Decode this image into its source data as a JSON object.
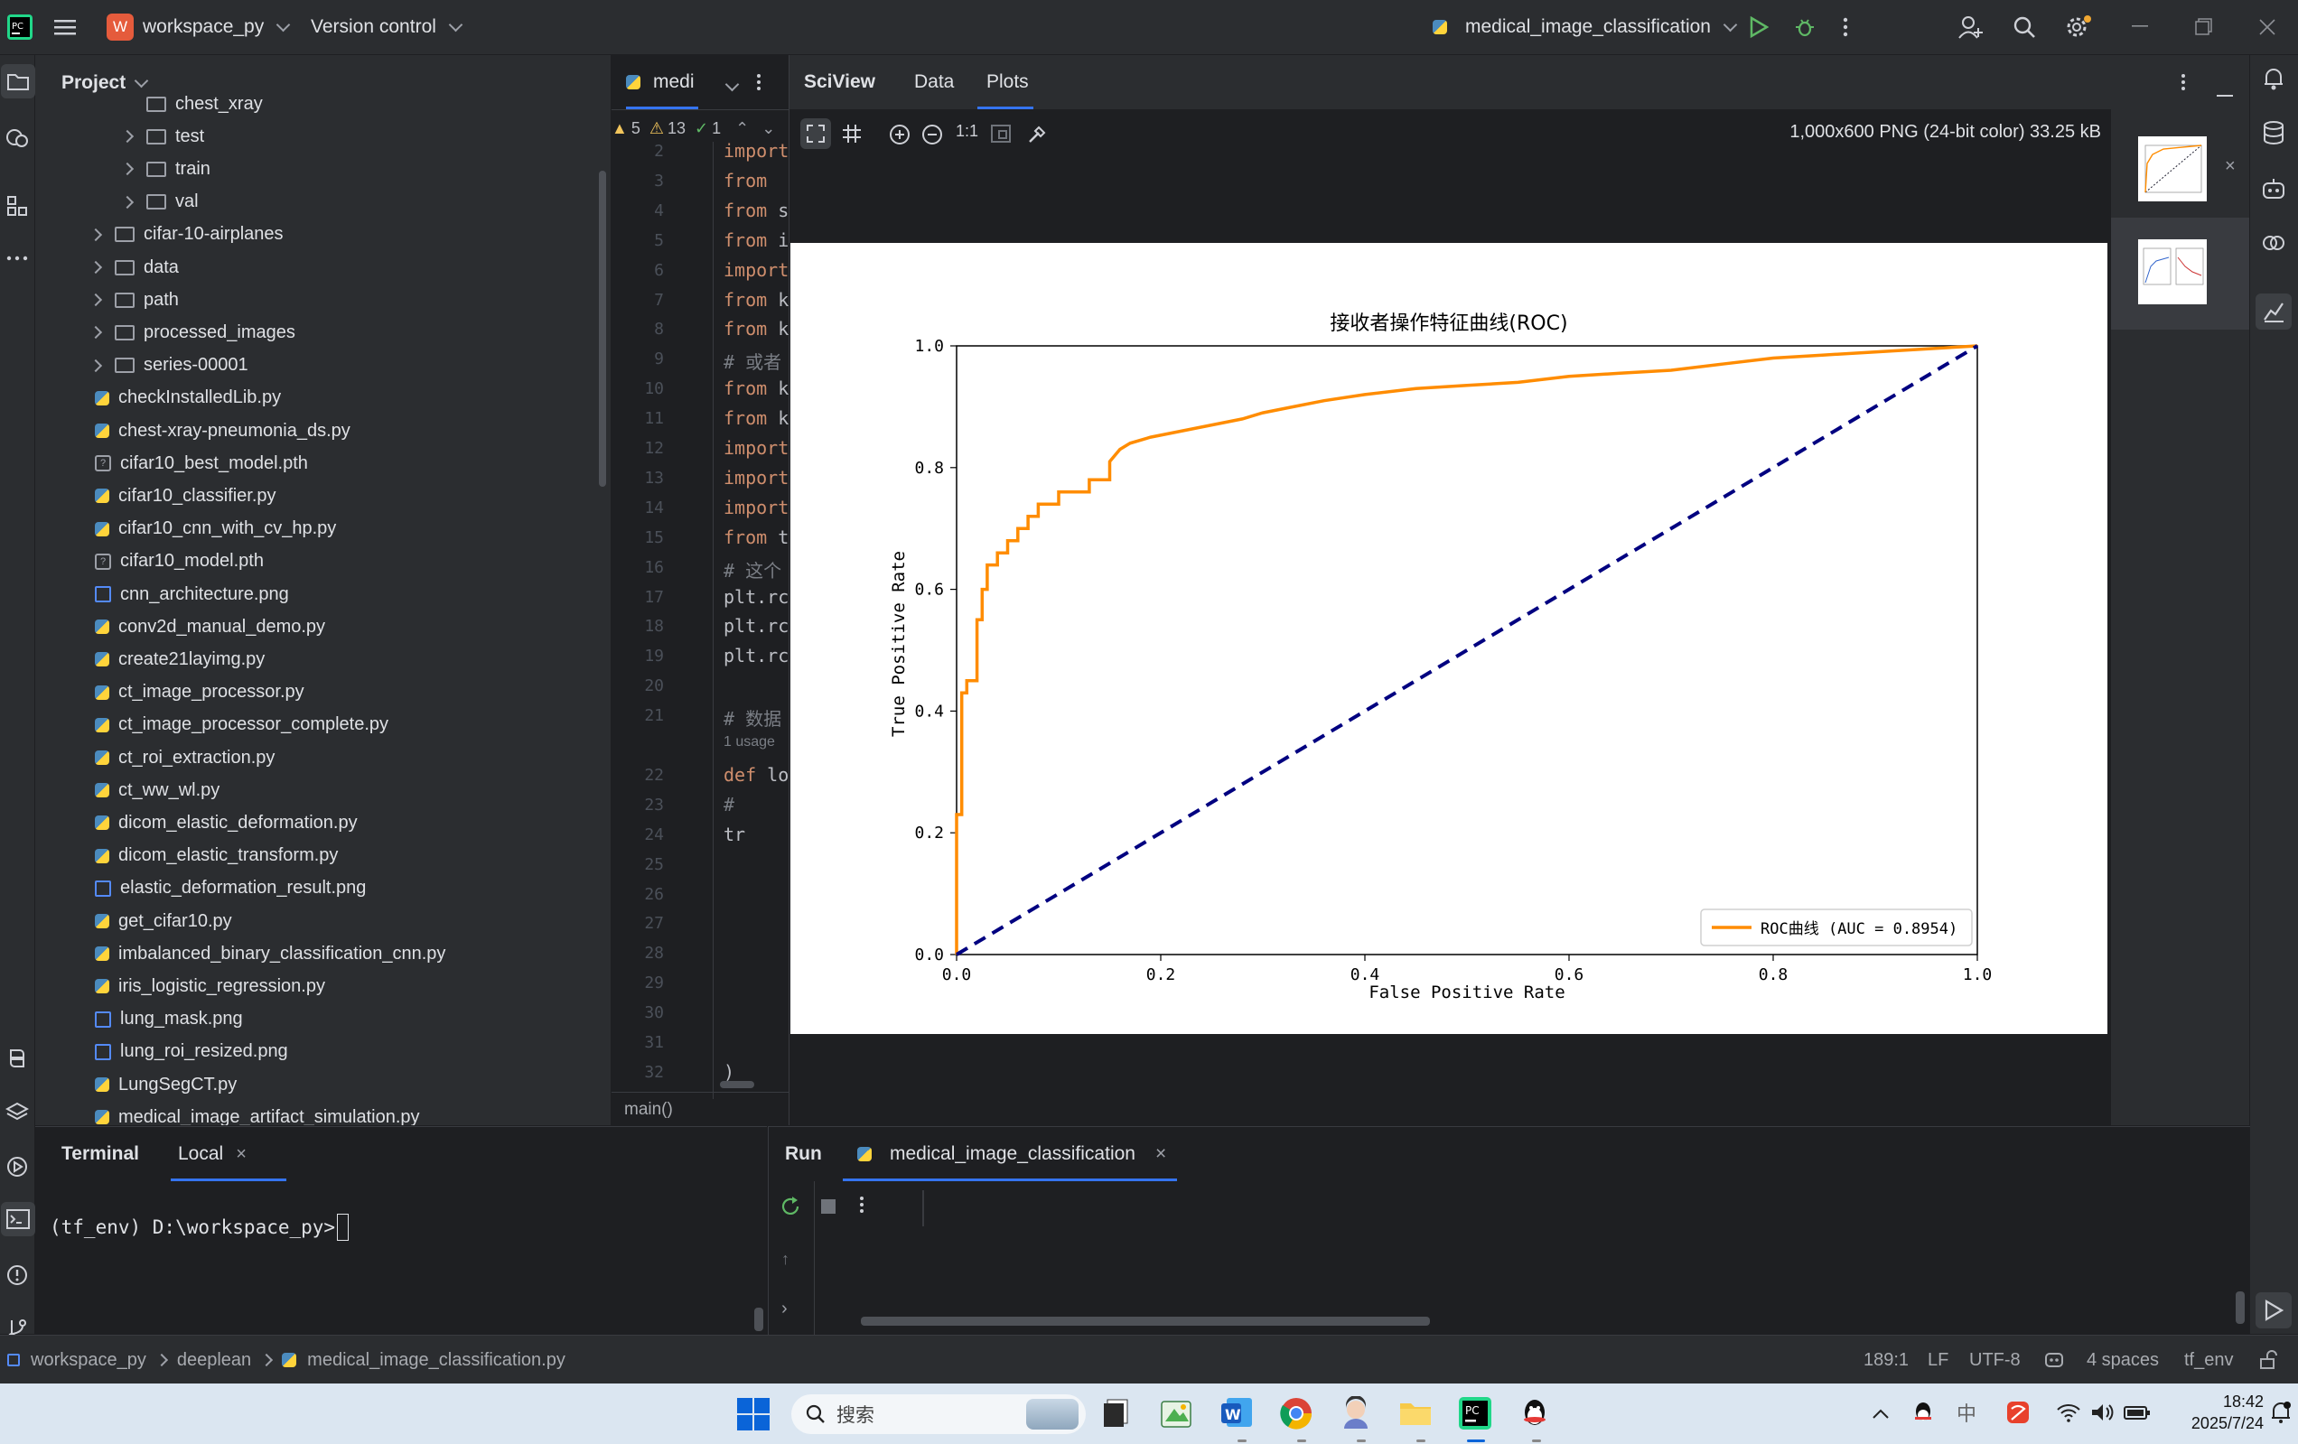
{
  "titlebar": {
    "project_name": "workspace_py",
    "project_badge": "W",
    "vcs": "Version control",
    "run_config": "medical_image_classification"
  },
  "project_panel": {
    "title": "Project",
    "items": [
      {
        "label": "chest_xray",
        "type": "folder",
        "depth": 2,
        "expand": "none"
      },
      {
        "label": "test",
        "type": "folder",
        "depth": 2,
        "expand": "collapsed"
      },
      {
        "label": "train",
        "type": "folder",
        "depth": 2,
        "expand": "collapsed"
      },
      {
        "label": "val",
        "type": "folder",
        "depth": 2,
        "expand": "collapsed"
      },
      {
        "label": "cifar-10-airplanes",
        "type": "folder",
        "depth": 1,
        "expand": "collapsed"
      },
      {
        "label": "data",
        "type": "folder",
        "depth": 1,
        "expand": "collapsed"
      },
      {
        "label": "path",
        "type": "folder",
        "depth": 1,
        "expand": "collapsed"
      },
      {
        "label": "processed_images",
        "type": "folder",
        "depth": 1,
        "expand": "collapsed"
      },
      {
        "label": "series-00001",
        "type": "folder",
        "depth": 1,
        "expand": "collapsed"
      },
      {
        "label": "checkInstalledLib.py",
        "type": "py",
        "depth": 1
      },
      {
        "label": "chest-xray-pneumonia_ds.py",
        "type": "py",
        "depth": 1
      },
      {
        "label": "cifar10_best_model.pth",
        "type": "unknown",
        "depth": 1
      },
      {
        "label": "cifar10_classifier.py",
        "type": "py",
        "depth": 1
      },
      {
        "label": "cifar10_cnn_with_cv_hp.py",
        "type": "py",
        "depth": 1
      },
      {
        "label": "cifar10_model.pth",
        "type": "unknown",
        "depth": 1
      },
      {
        "label": "cnn_architecture.png",
        "type": "img",
        "depth": 1
      },
      {
        "label": "conv2d_manual_demo.py",
        "type": "py",
        "depth": 1
      },
      {
        "label": "create21layimg.py",
        "type": "py",
        "depth": 1
      },
      {
        "label": "ct_image_processor.py",
        "type": "py",
        "depth": 1
      },
      {
        "label": "ct_image_processor_complete.py",
        "type": "py",
        "depth": 1
      },
      {
        "label": "ct_roi_extraction.py",
        "type": "py",
        "depth": 1
      },
      {
        "label": "ct_ww_wl.py",
        "type": "py",
        "depth": 1
      },
      {
        "label": "dicom_elastic_deformation.py",
        "type": "py",
        "depth": 1
      },
      {
        "label": "dicom_elastic_transform.py",
        "type": "py",
        "depth": 1
      },
      {
        "label": "elastic_deformation_result.png",
        "type": "img",
        "depth": 1
      },
      {
        "label": "get_cifar10.py",
        "type": "py",
        "depth": 1
      },
      {
        "label": "imbalanced_binary_classification_cnn.py",
        "type": "py",
        "depth": 1
      },
      {
        "label": "iris_logistic_regression.py",
        "type": "py",
        "depth": 1
      },
      {
        "label": "lung_mask.png",
        "type": "img",
        "depth": 1
      },
      {
        "label": "lung_roi_resized.png",
        "type": "img",
        "depth": 1
      },
      {
        "label": "LungSegCT.py",
        "type": "py",
        "depth": 1
      },
      {
        "label": "medical_image_artifact_simulation.py",
        "type": "py",
        "depth": 1
      }
    ]
  },
  "editor": {
    "tab_label": "medi",
    "warnings": "5",
    "weak_warnings": "13",
    "checks": "1",
    "lines": [
      {
        "n": "2",
        "k": "import",
        "r": ""
      },
      {
        "n": "3",
        "k": "from",
        "r": ""
      },
      {
        "n": "4",
        "k": "from",
        "r": " s"
      },
      {
        "n": "5",
        "k": "from",
        "r": " i"
      },
      {
        "n": "6",
        "k": "import",
        "r": ""
      },
      {
        "n": "7",
        "k": "from",
        "r": " k"
      },
      {
        "n": "8",
        "k": "from",
        "r": " k"
      },
      {
        "n": "9",
        "k": "",
        "r": "# 或者"
      },
      {
        "n": "10",
        "k": "from",
        "r": " k"
      },
      {
        "n": "11",
        "k": "from",
        "r": " k"
      },
      {
        "n": "12",
        "k": "import",
        "r": ""
      },
      {
        "n": "13",
        "k": "import",
        "r": ""
      },
      {
        "n": "14",
        "k": "import",
        "r": ""
      },
      {
        "n": "15",
        "k": "from",
        "r": " t"
      },
      {
        "n": "16",
        "k": "",
        "r": "#  这个"
      },
      {
        "n": "17",
        "k": "",
        "r": "plt.rc"
      },
      {
        "n": "18",
        "k": "",
        "r": "plt.rc"
      },
      {
        "n": "19",
        "k": "",
        "r": "plt.rc"
      },
      {
        "n": "20",
        "k": "",
        "r": ""
      },
      {
        "n": "21",
        "k": "",
        "r": "# 数据"
      }
    ],
    "usage_hint": "1 usage",
    "lines2": [
      {
        "n": "22",
        "k": "def",
        "r": " lo"
      },
      {
        "n": "23",
        "k": "",
        "r": "    #"
      },
      {
        "n": "24",
        "k": "",
        "r": "    tr"
      },
      {
        "n": "25",
        "k": "",
        "r": ""
      },
      {
        "n": "26",
        "k": "",
        "r": ""
      },
      {
        "n": "27",
        "k": "",
        "r": ""
      },
      {
        "n": "28",
        "k": "",
        "r": ""
      },
      {
        "n": "29",
        "k": "",
        "r": ""
      },
      {
        "n": "30",
        "k": "",
        "r": ""
      },
      {
        "n": "31",
        "k": "",
        "r": ""
      },
      {
        "n": "32",
        "k": "",
        "r": "    )"
      }
    ],
    "breadcrumb": "main()"
  },
  "sciview": {
    "tabs": [
      "SciView",
      "Data",
      "Plots"
    ],
    "image_info": "1,000x600 PNG (24-bit color) 33.25 kB",
    "zoom_label": "1:1"
  },
  "chart_data": {
    "type": "line",
    "title": "接收者操作特征曲线(ROC)",
    "xlabel": "False Positive Rate",
    "ylabel": "True Positive Rate",
    "xlim": [
      0.0,
      1.0
    ],
    "ylim": [
      0.0,
      1.0
    ],
    "xticks": [
      "0.0",
      "0.2",
      "0.4",
      "0.6",
      "0.8",
      "1.0"
    ],
    "yticks": [
      "0.0",
      "0.2",
      "0.4",
      "0.6",
      "0.8",
      "1.0"
    ],
    "legend_position": "lower-right",
    "grid": false,
    "series": [
      {
        "name": "ROC曲线 (AUC = 0.8954)",
        "color": "#ff8c00",
        "style": "solid",
        "x": [
          0.0,
          0.0,
          0.005,
          0.005,
          0.01,
          0.01,
          0.02,
          0.02,
          0.025,
          0.025,
          0.03,
          0.03,
          0.04,
          0.04,
          0.05,
          0.05,
          0.06,
          0.06,
          0.07,
          0.07,
          0.08,
          0.08,
          0.1,
          0.1,
          0.13,
          0.13,
          0.15,
          0.15,
          0.16,
          0.17,
          0.19,
          0.22,
          0.25,
          0.28,
          0.3,
          0.33,
          0.36,
          0.4,
          0.45,
          0.5,
          0.55,
          0.6,
          0.65,
          0.7,
          0.75,
          0.8,
          0.85,
          0.9,
          0.95,
          1.0
        ],
        "y": [
          0.0,
          0.23,
          0.23,
          0.43,
          0.43,
          0.45,
          0.45,
          0.55,
          0.55,
          0.6,
          0.6,
          0.64,
          0.64,
          0.66,
          0.66,
          0.68,
          0.68,
          0.7,
          0.7,
          0.72,
          0.72,
          0.74,
          0.74,
          0.76,
          0.76,
          0.78,
          0.78,
          0.81,
          0.83,
          0.84,
          0.85,
          0.86,
          0.87,
          0.88,
          0.89,
          0.9,
          0.91,
          0.92,
          0.93,
          0.935,
          0.94,
          0.95,
          0.955,
          0.96,
          0.97,
          0.98,
          0.985,
          0.99,
          0.995,
          1.0
        ]
      },
      {
        "name": "",
        "color": "#000080",
        "style": "dashed",
        "x": [
          0.0,
          1.0
        ],
        "y": [
          0.0,
          1.0
        ]
      }
    ]
  },
  "terminal": {
    "tab_title": "Terminal",
    "session_tab": "Local",
    "prompt": "(tf_env) D:\\workspace_py>"
  },
  "run": {
    "title": "Run",
    "config_tab": "medical_image_classification"
  },
  "statusbar": {
    "crumbs": [
      "workspace_py",
      "deeplean",
      "medical_image_classification.py"
    ],
    "position": "189:1",
    "line_sep": "LF",
    "encoding": "UTF-8",
    "indent": "4 spaces",
    "interpreter": "tf_env"
  },
  "taskbar": {
    "search_placeholder": "搜索",
    "time": "18:42",
    "date": "2025/7/24",
    "ime": "中"
  }
}
